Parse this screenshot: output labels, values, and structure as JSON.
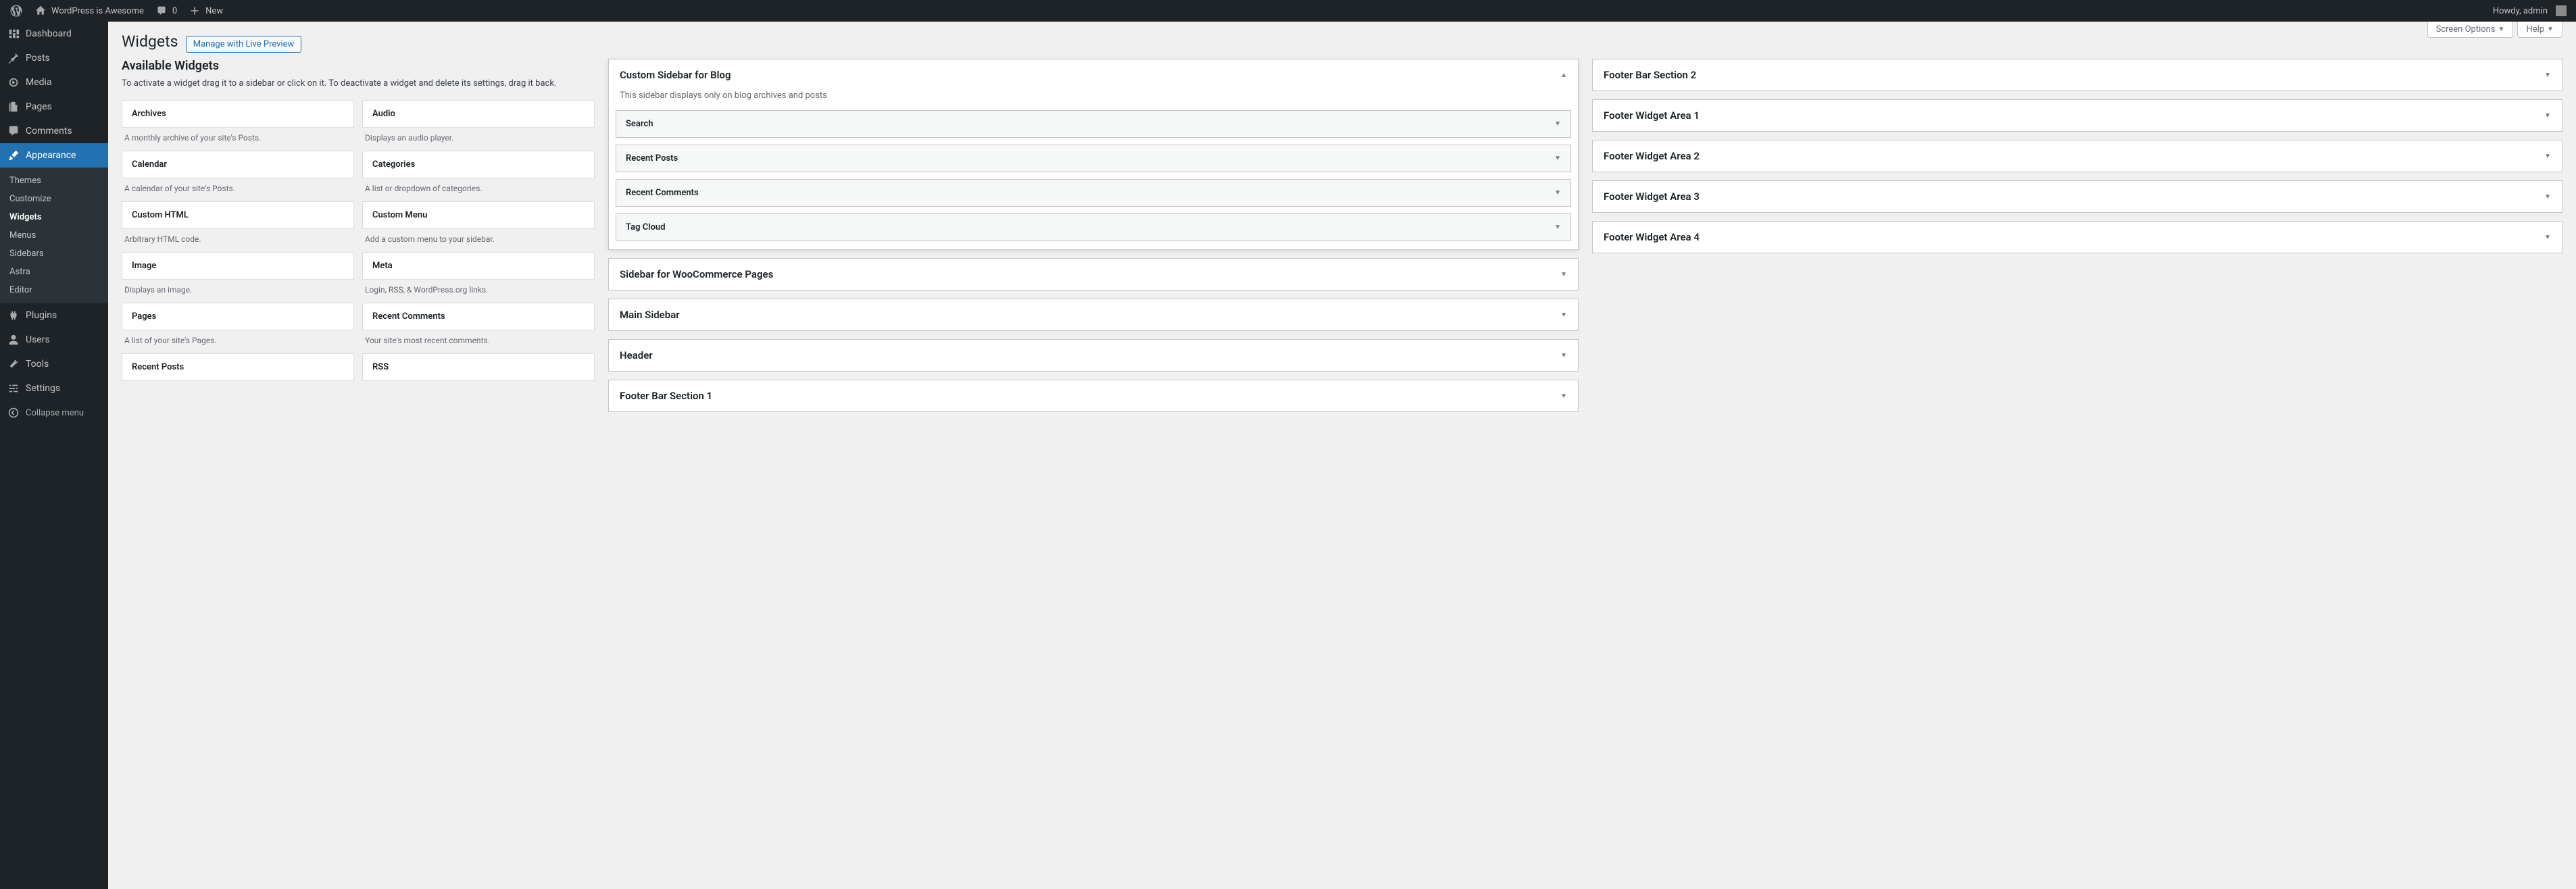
{
  "adminbar": {
    "site_name": "WordPress is Awesome",
    "comments_count": "0",
    "new_label": "New",
    "howdy": "Howdy, admin"
  },
  "menu": {
    "dashboard": "Dashboard",
    "posts": "Posts",
    "media": "Media",
    "pages": "Pages",
    "comments": "Comments",
    "appearance": "Appearance",
    "themes": "Themes",
    "customize": "Customize",
    "widgets": "Widgets",
    "menus": "Menus",
    "sidebars": "Sidebars",
    "astra": "Astra",
    "editor": "Editor",
    "plugins": "Plugins",
    "users": "Users",
    "tools": "Tools",
    "settings": "Settings",
    "collapse": "Collapse menu"
  },
  "screen_meta": {
    "screen_options": "Screen Options",
    "help": "Help"
  },
  "page": {
    "title": "Widgets",
    "title_action": "Manage with Live Preview",
    "available_heading": "Available Widgets",
    "available_desc": "To activate a widget drag it to a sidebar or click on it. To deactivate a widget and delete its settings, drag it back."
  },
  "available": [
    {
      "title": "Archives",
      "desc": "A monthly archive of your site's Posts."
    },
    {
      "title": "Audio",
      "desc": "Displays an audio player."
    },
    {
      "title": "Calendar",
      "desc": "A calendar of your site's Posts."
    },
    {
      "title": "Categories",
      "desc": "A list or dropdown of categories."
    },
    {
      "title": "Custom HTML",
      "desc": "Arbitrary HTML code."
    },
    {
      "title": "Custom Menu",
      "desc": "Add a custom menu to your sidebar."
    },
    {
      "title": "Image",
      "desc": "Displays an image."
    },
    {
      "title": "Meta",
      "desc": "Login, RSS, & WordPress.org links."
    },
    {
      "title": "Pages",
      "desc": "A list of your site's Pages."
    },
    {
      "title": "Recent Comments",
      "desc": "Your site's most recent comments."
    },
    {
      "title": "Recent Posts",
      "desc": ""
    },
    {
      "title": "RSS",
      "desc": ""
    }
  ],
  "areas_left": {
    "custom_sidebar": {
      "title": "Custom Sidebar for Blog",
      "desc": "This sidebar displays only on blog archives and posts",
      "widgets": [
        "Search",
        "Recent Posts",
        "Recent Comments",
        "Tag Cloud"
      ]
    },
    "woo": "Sidebar for WooCommerce Pages",
    "main": "Main Sidebar",
    "header": "Header",
    "footer_bar_1": "Footer Bar Section 1"
  },
  "areas_right": {
    "footer_bar_2": "Footer Bar Section 2",
    "fwa1": "Footer Widget Area 1",
    "fwa2": "Footer Widget Area 2",
    "fwa3": "Footer Widget Area 3",
    "fwa4": "Footer Widget Area 4"
  }
}
